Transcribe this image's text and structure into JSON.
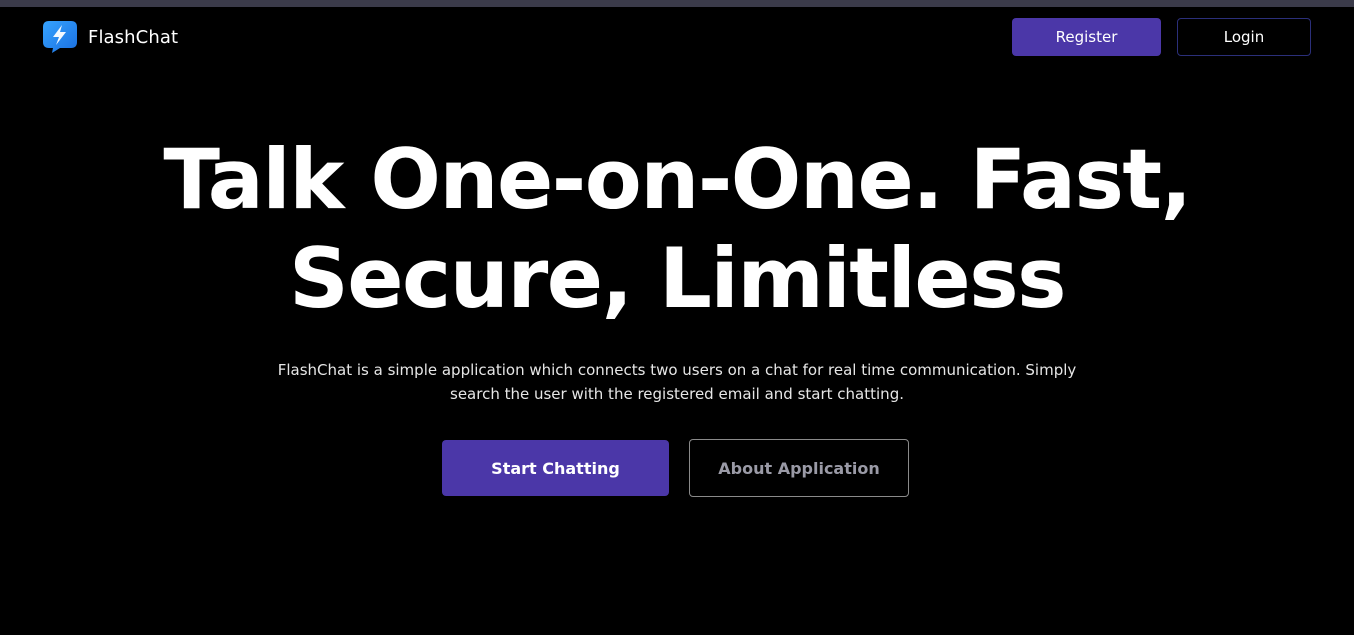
{
  "brand": {
    "name": "FlashChat",
    "icon": "lightning-chat-icon"
  },
  "nav": {
    "register_label": "Register",
    "login_label": "Login"
  },
  "hero": {
    "title_line1": "Talk One-on-One. Fast,",
    "title_line2": "Secure, Limitless",
    "description": "FlashChat is a simple application which connects two users on a chat for real time communication. Simply search the user with the registered email and start chatting.",
    "primary_cta": "Start Chatting",
    "secondary_cta": "About Application"
  },
  "colors": {
    "background": "#000000",
    "accent": "#4b37a8",
    "top_strip": "#3b3b4a",
    "icon_blue": "#2a8cf0"
  }
}
